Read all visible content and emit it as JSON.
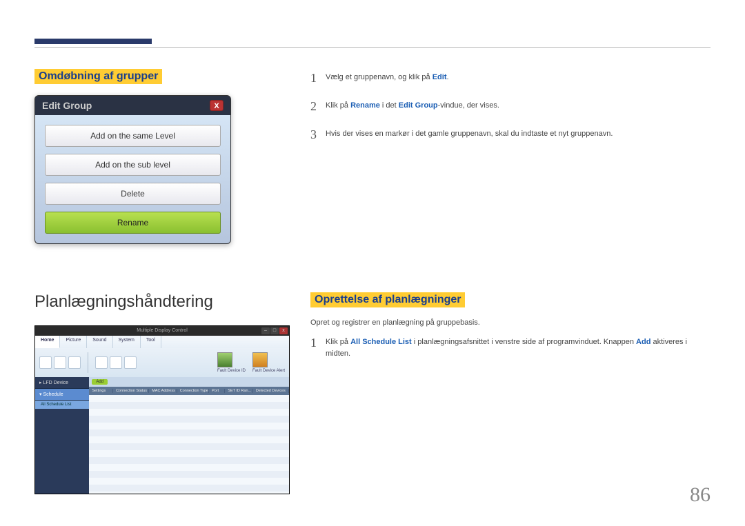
{
  "page_number": "86",
  "section1": {
    "heading": "Omdøbning af grupper",
    "steps": [
      {
        "pre": "Vælg et gruppenavn, og klik på ",
        "em": "Edit",
        "post": "."
      },
      {
        "pre": "Klik på ",
        "em": "Rename",
        "mid": " i det ",
        "em2": "Edit Group",
        "post": "-vindue, der vises."
      },
      {
        "pre": "Hvis der vises en markør i det gamle gruppenavn, skal du indtaste et nyt gruppenavn."
      }
    ],
    "dialog": {
      "title": "Edit Group",
      "buttons": [
        "Add on the same Level",
        "Add on the sub level",
        "Delete",
        "Rename"
      ]
    }
  },
  "section2": {
    "heading": "Planlægningshåndtering",
    "sub_heading": "Oprettelse af planlægninger",
    "intro": "Opret og registrer en planlægning på gruppebasis.",
    "steps": [
      {
        "pre": "Klik på ",
        "em": "All Schedule List",
        "mid": " i planlægningsafsnittet i venstre side af programvinduet. Knappen ",
        "em2": "Add",
        "post": " aktiveres i midten."
      }
    ]
  },
  "mdc": {
    "title": "Multiple Display Control",
    "tabs": [
      "Home",
      "Picture",
      "Sound",
      "System",
      "Tool"
    ],
    "ribbon_labels": [
      "Fault Device ID",
      "Fault Device Alert"
    ],
    "sidebar": {
      "items": [
        "LFD Device",
        "Schedule"
      ],
      "sub": "All Schedule List"
    },
    "toolbar_chip": "Add",
    "columns": [
      "Settings",
      "Connection Status",
      "MAC Address",
      "Connection Type",
      "Port",
      "SET ID Ran...",
      "Detected Devices"
    ]
  }
}
